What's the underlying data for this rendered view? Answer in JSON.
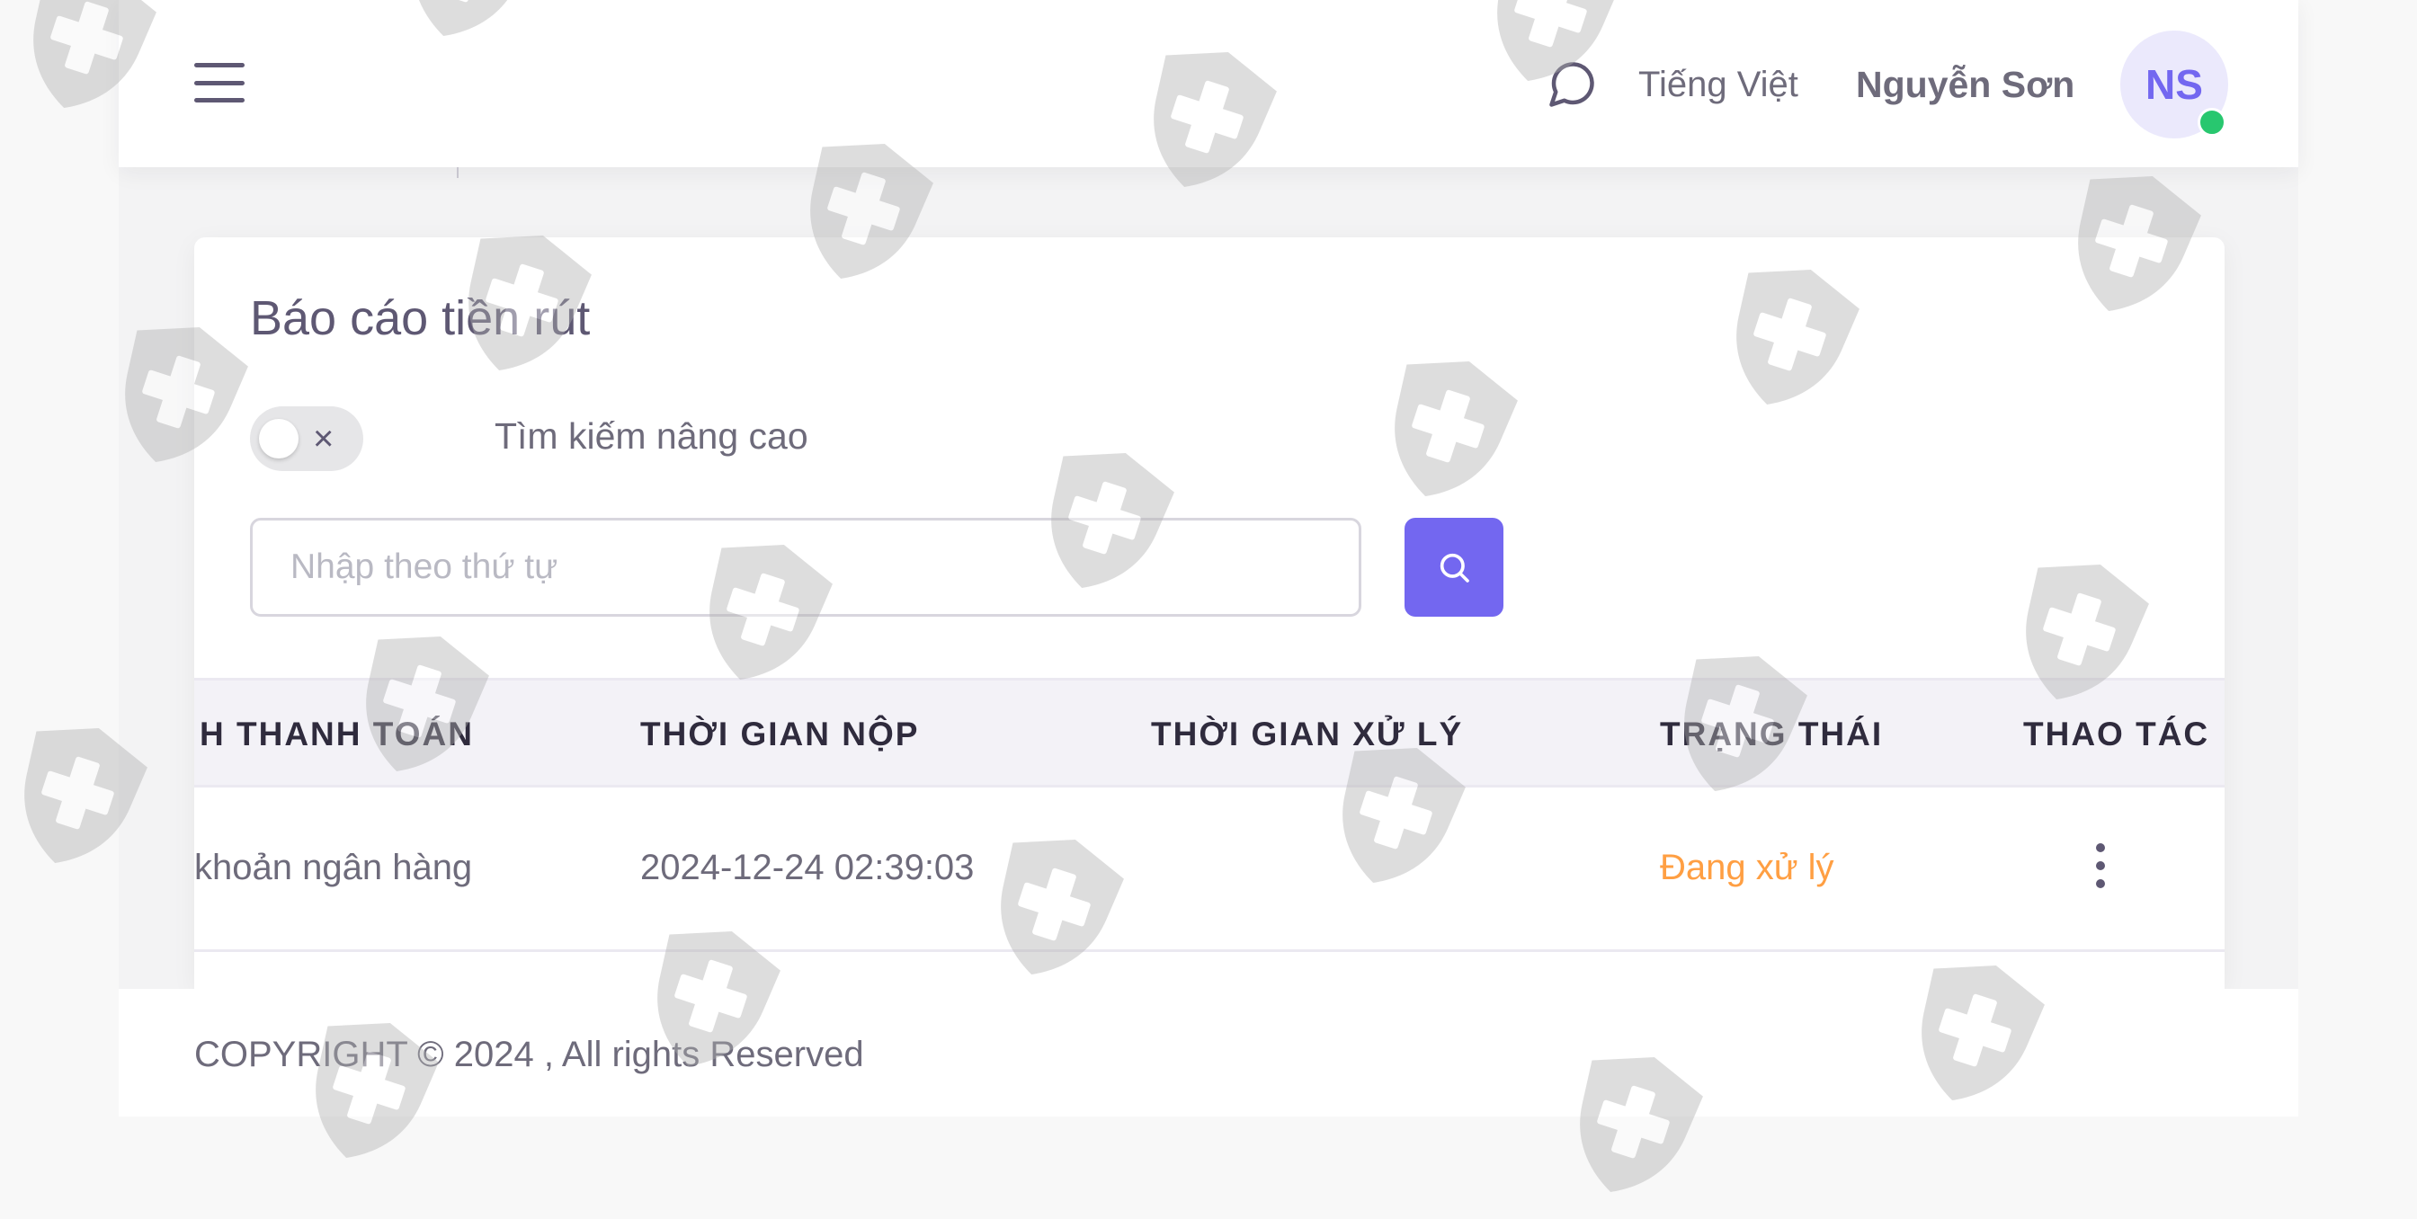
{
  "header": {
    "language": "Tiếng Việt",
    "user_name": "Nguyễn Sơn",
    "avatar_initials": "NS",
    "icons": [
      "menu-icon",
      "chat-icon"
    ]
  },
  "report": {
    "title": "Báo cáo tiền rút",
    "advanced_search_label": "Tìm kiếm nâng cao",
    "advanced_search_enabled": false,
    "search_placeholder": "Nhập theo thứ tự",
    "search_value": ""
  },
  "table": {
    "columns": [
      "H THANH TOÁN",
      "THỜI GIAN NỘP",
      "THỜI GIAN XỬ LÝ",
      "TRẠNG THÁI",
      "THAO TÁC"
    ],
    "rows": [
      {
        "payment_method": "khoản ngân hàng",
        "submitted_at": "2024-12-24 02:39:03",
        "processed_at": "",
        "status": "Đang xử lý"
      }
    ]
  },
  "footer": {
    "copyright": "COPYRIGHT © 2024 , All rights Reserved"
  },
  "colors": {
    "primary": "#7367f0",
    "status_pending": "#ff9f43",
    "online": "#28c76f"
  }
}
